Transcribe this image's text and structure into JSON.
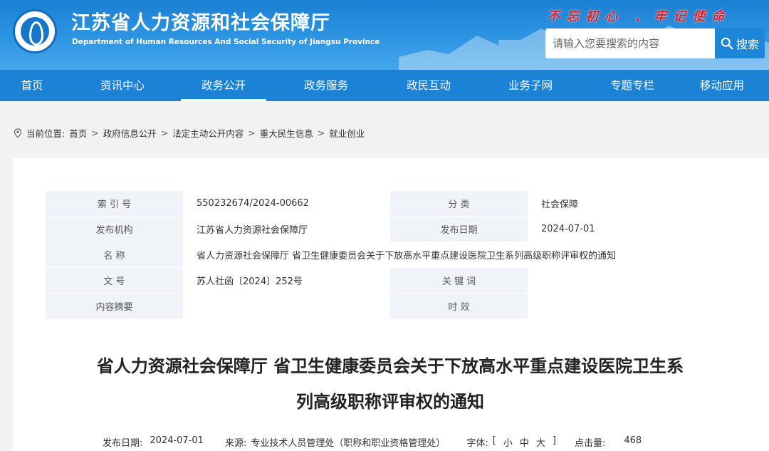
{
  "header": {
    "site_title": "江苏省人力资源和社会保障厅",
    "site_subtitle": "Department of Human Resources And Social Security of Jiangsu Province",
    "slogan": "不忘初心 、牢记使命",
    "search_placeholder": "请输入您要搜索的内容",
    "search_button": "搜索"
  },
  "nav": {
    "items": [
      "首页",
      "资讯中心",
      "政务公开",
      "政务服务",
      "政民互动",
      "业务子网",
      "专题专栏",
      "移动应用"
    ],
    "active_index": 2
  },
  "breadcrumb": {
    "prefix": "当前位置:",
    "items": [
      "首页",
      "政府信息公开",
      "法定主动公开内容",
      "重大民生信息",
      "就业创业"
    ]
  },
  "meta": {
    "index_label": "索 引 号",
    "index_value": "550232674/2024-00662",
    "category_label": "分 类",
    "category_value": "社会保障",
    "publisher_label": "发布机构",
    "publisher_value": "江苏省人力资源社会保障厅",
    "date_label": "发布日期",
    "date_value": "2024-07-01",
    "name_label": "名 称",
    "name_value": "省人力资源社会保障厅 省卫生健康委员会关于下放高水平重点建设医院卫生系列高级职称评审权的通知",
    "doc_no_label": "文 号",
    "doc_no_value": "苏人社函〔2024〕252号",
    "keywords_label": "关 键 词",
    "keywords_value": "",
    "summary_label": "内容摘要",
    "summary_value": "",
    "validity_label": "时 效",
    "validity_value": ""
  },
  "article": {
    "title_line1": "省人力资源社会保障厅 省卫生健康委员会关于下放高水平重点建设医院卫生系",
    "title_line2": "列高级职称评审权的通知",
    "pub_date_label": "发布日期:",
    "pub_date": "2024-07-01",
    "source_label": "来源:",
    "source": "专业技术人员管理处（职称和职业资格管理处）",
    "font_label": "字体:",
    "font_open": "[",
    "font_small": "小",
    "font_medium": "中",
    "font_large": "大",
    "font_close": "]",
    "clicks_label": "点击量:",
    "clicks": "468"
  },
  "colors": {
    "header_blue": "#1b7fd2",
    "nav_blue": "#1c82d6",
    "slogan_red": "#d8202b",
    "table_label_bg": "#f0f4f8"
  }
}
